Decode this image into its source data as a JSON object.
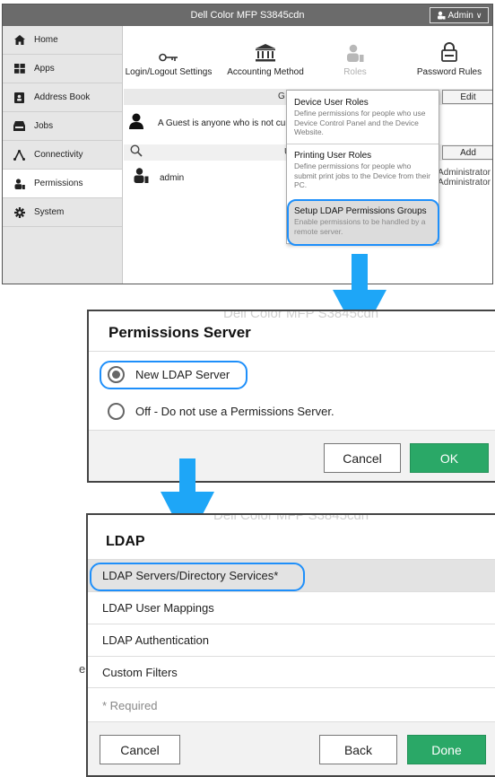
{
  "panel1": {
    "window_title": "Dell Color MFP S3845cdn",
    "admin_label": "Admin",
    "sidebar": [
      {
        "label": "Home",
        "icon": "home-icon"
      },
      {
        "label": "Apps",
        "icon": "apps-grid-icon"
      },
      {
        "label": "Address Book",
        "icon": "address-book-icon"
      },
      {
        "label": "Jobs",
        "icon": "jobs-tray-icon"
      },
      {
        "label": "Connectivity",
        "icon": "connectivity-icon"
      },
      {
        "label": "Permissions",
        "icon": "permissions-user-icon",
        "active": true
      },
      {
        "label": "System",
        "icon": "gear-icon"
      }
    ],
    "toolbar": [
      {
        "label": "Login/Logout Settings",
        "icon": "key-icon"
      },
      {
        "label": "Accounting Method",
        "icon": "bank-icon"
      },
      {
        "label": "Roles",
        "icon": "roles-user-icon",
        "dimmed": true
      },
      {
        "label": "Password Rules",
        "icon": "lock-icon"
      }
    ],
    "guest_bar_fragment": "G",
    "edit_button": "Edit",
    "guest_text": "A Guest is anyone who is not curre",
    "users_bar_fragment": "U",
    "add_button": "Add",
    "user_name": "admin",
    "role_text_1": "em Administrator",
    "role_text_2": "em Administrator",
    "dropdown": [
      {
        "title": "Device User Roles",
        "desc": "Define permissions for people who use Device Control Panel and the Device Website."
      },
      {
        "title": "Printing User Roles",
        "desc": "Define permissions for people who submit print jobs to the Device from their PC."
      },
      {
        "title": "Setup LDAP Permissions Groups",
        "desc": "Enable permissions to be handled by a remote server."
      }
    ]
  },
  "panel2": {
    "ghost_title": "Dell Color MFP S3845cdn",
    "title": "Permissions Server",
    "options": [
      {
        "label": "New LDAP Server",
        "selected": true
      },
      {
        "label": "Off - Do not use a Permissions Server.",
        "selected": false
      }
    ],
    "cancel": "Cancel",
    "ok": "OK"
  },
  "panel3": {
    "ghost_title": "Dell Color MFP S3845cdn",
    "title": "LDAP",
    "items": [
      "LDAP Servers/Directory Services*",
      "LDAP User Mappings",
      "LDAP Authentication",
      "Custom Filters"
    ],
    "required_note": "* Required",
    "cancel": "Cancel",
    "back": "Back",
    "done": "Done",
    "behind_fragment": "e"
  },
  "colors": {
    "accent_blue": "#1ea6f7",
    "highlight_ring": "#1e8ffa",
    "ok_green": "#2aa867",
    "titlebar_gray": "#6b6b6b"
  }
}
